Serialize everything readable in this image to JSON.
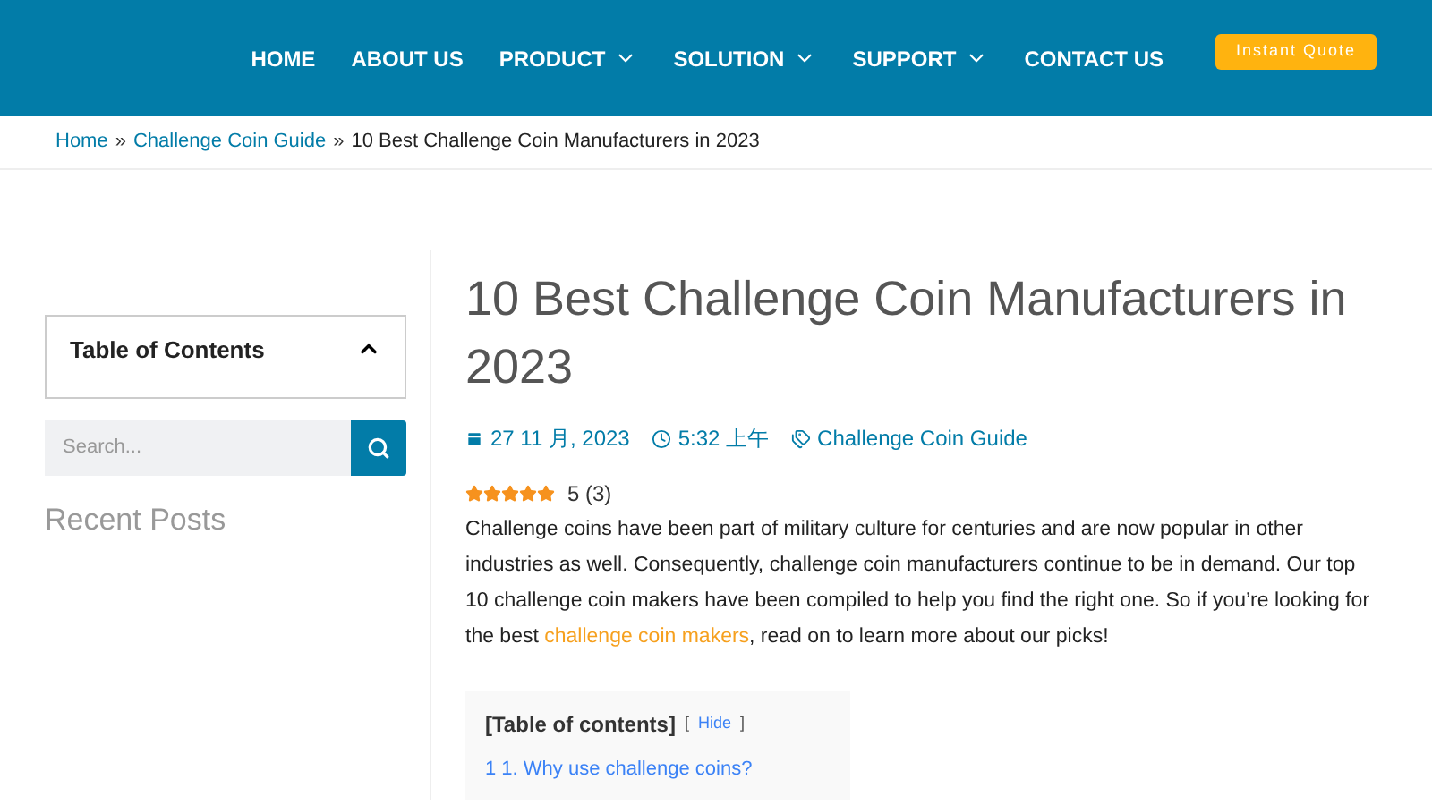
{
  "nav": {
    "items": [
      {
        "label": "HOME",
        "has_menu": false
      },
      {
        "label": "ABOUT US",
        "has_menu": false
      },
      {
        "label": "PRODUCT",
        "has_menu": true
      },
      {
        "label": "SOLUTION",
        "has_menu": true
      },
      {
        "label": "SUPPORT",
        "has_menu": true
      },
      {
        "label": "CONTACT US",
        "has_menu": false
      }
    ],
    "cta": "Instant Quote"
  },
  "breadcrumb": {
    "links": [
      "Home",
      "Challenge Coin Guide"
    ],
    "separator": "»",
    "current": "10 Best Challenge Coin Manufacturers in 2023"
  },
  "sidebar": {
    "toc": {
      "title": "Table of Contents",
      "expanded": true
    },
    "search": {
      "placeholder": "Search..."
    },
    "recent_title": "Recent Posts"
  },
  "article": {
    "title": "10 Best Challenge Coin Manufacturers in 2023",
    "date": "27 11 月, 2023",
    "time": "5:32 上午",
    "category": "Challenge Coin Guide",
    "rating": {
      "stars": 5,
      "text": "5 (3)"
    },
    "intro": {
      "before": "Challenge coins have been part of military culture for centuries and are now popular in other industries as well. Consequently, challenge coin manufacturers continue to be in demand. Our top 10 challenge coin makers have been compiled to help you find the right one. So if you’re looking for the best ",
      "link": "challenge coin makers",
      "after": ", read on to learn more about our picks!"
    },
    "toc": {
      "title": "[Table of contents]",
      "open": "[",
      "toggle": "Hide",
      "close": "]",
      "items": [
        "1 1. Why use challenge coins?"
      ]
    }
  }
}
